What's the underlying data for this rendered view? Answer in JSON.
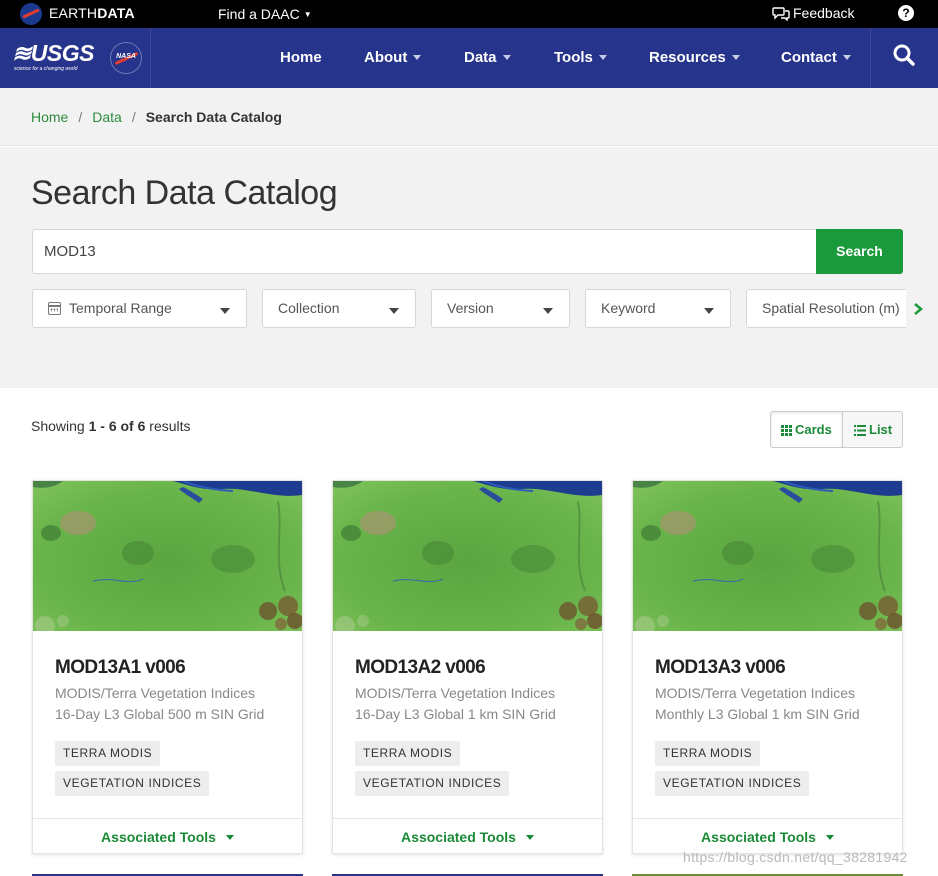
{
  "topbar": {
    "brand_light": "EARTH",
    "brand_bold": "DATA",
    "find_daac": "Find a DAAC",
    "feedback": "Feedback",
    "help": "?"
  },
  "nav": {
    "usgs": "≋USGS",
    "usgs_tagline": "science for a changing world",
    "nasa": "NASA",
    "items": [
      {
        "label": "Home",
        "dropdown": false
      },
      {
        "label": "About",
        "dropdown": true
      },
      {
        "label": "Data",
        "dropdown": true
      },
      {
        "label": "Tools",
        "dropdown": true
      },
      {
        "label": "Resources",
        "dropdown": true
      },
      {
        "label": "Contact",
        "dropdown": true
      }
    ]
  },
  "breadcrumb": {
    "items": [
      "Home",
      "Data"
    ],
    "separator": "/",
    "current": "Search Data Catalog"
  },
  "search": {
    "title": "Search Data Catalog",
    "query": "MOD13",
    "button": "Search",
    "filters": [
      "Temporal Range",
      "Collection",
      "Version",
      "Keyword",
      "Spatial Resolution (m)"
    ]
  },
  "results": {
    "showing_prefix": "Showing",
    "range": "1 - 6 of 6",
    "suffix": "results",
    "view_cards": "Cards",
    "view_list": "List"
  },
  "cards": [
    {
      "title": "MOD13A1 v006",
      "desc1": "MODIS/Terra Vegetation Indices",
      "desc2": "16-Day L3 Global 500 m SIN Grid",
      "tags": [
        "TERRA MODIS",
        "VEGETATION INDICES"
      ],
      "tools": "Associated Tools"
    },
    {
      "title": "MOD13A2 v006",
      "desc1": "MODIS/Terra Vegetation Indices",
      "desc2": "16-Day L3 Global 1 km SIN Grid",
      "tags": [
        "TERRA MODIS",
        "VEGETATION INDICES"
      ],
      "tools": "Associated Tools"
    },
    {
      "title": "MOD13A3 v006",
      "desc1": "MODIS/Terra Vegetation Indices",
      "desc2": "Monthly L3 Global 1 km SIN Grid",
      "tags": [
        "TERRA MODIS",
        "VEGETATION INDICES"
      ],
      "tools": "Associated Tools"
    }
  ],
  "watermark": "https://blog.csdn.net/qq_38281942",
  "colors": {
    "navy": "#26348b",
    "green": "#1b9a3c",
    "link_green": "#2e8b3d",
    "band": "#f2f2f2"
  }
}
